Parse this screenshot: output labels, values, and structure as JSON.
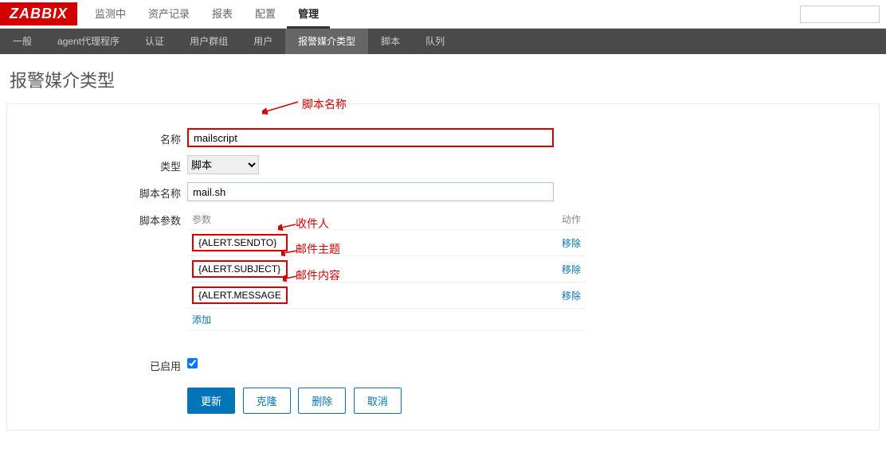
{
  "logo": "ZABBIX",
  "topNav": {
    "items": [
      "监测中",
      "资产记录",
      "报表",
      "配置",
      "管理"
    ],
    "activeIndex": 4
  },
  "subNav": {
    "items": [
      "一般",
      "agent代理程序",
      "认证",
      "用户群组",
      "用户",
      "报警媒介类型",
      "脚本",
      "队列"
    ],
    "activeIndex": 5
  },
  "pageTitle": "报警媒介类型",
  "form": {
    "nameLabel": "名称",
    "nameValue": "mailscript",
    "typeLabel": "类型",
    "typeValue": "脚本",
    "scriptNameLabel": "脚本名称",
    "scriptNameValue": "mail.sh",
    "scriptParamsLabel": "脚本参数",
    "paramsHeaderParam": "参数",
    "paramsHeaderAction": "动作",
    "params": [
      {
        "value": "{ALERT.SENDTO}"
      },
      {
        "value": "{ALERT.SUBJECT}"
      },
      {
        "value": "{ALERT.MESSAGE}"
      }
    ],
    "removeLabel": "移除",
    "addLabel": "添加",
    "enabledLabel": "已启用",
    "enabled": true
  },
  "buttons": {
    "update": "更新",
    "clone": "克隆",
    "delete": "删除",
    "cancel": "取消"
  },
  "annotations": {
    "scriptName": "脚本名称",
    "recipient": "收件人",
    "subject": "邮件主题",
    "content": "邮件内容"
  }
}
